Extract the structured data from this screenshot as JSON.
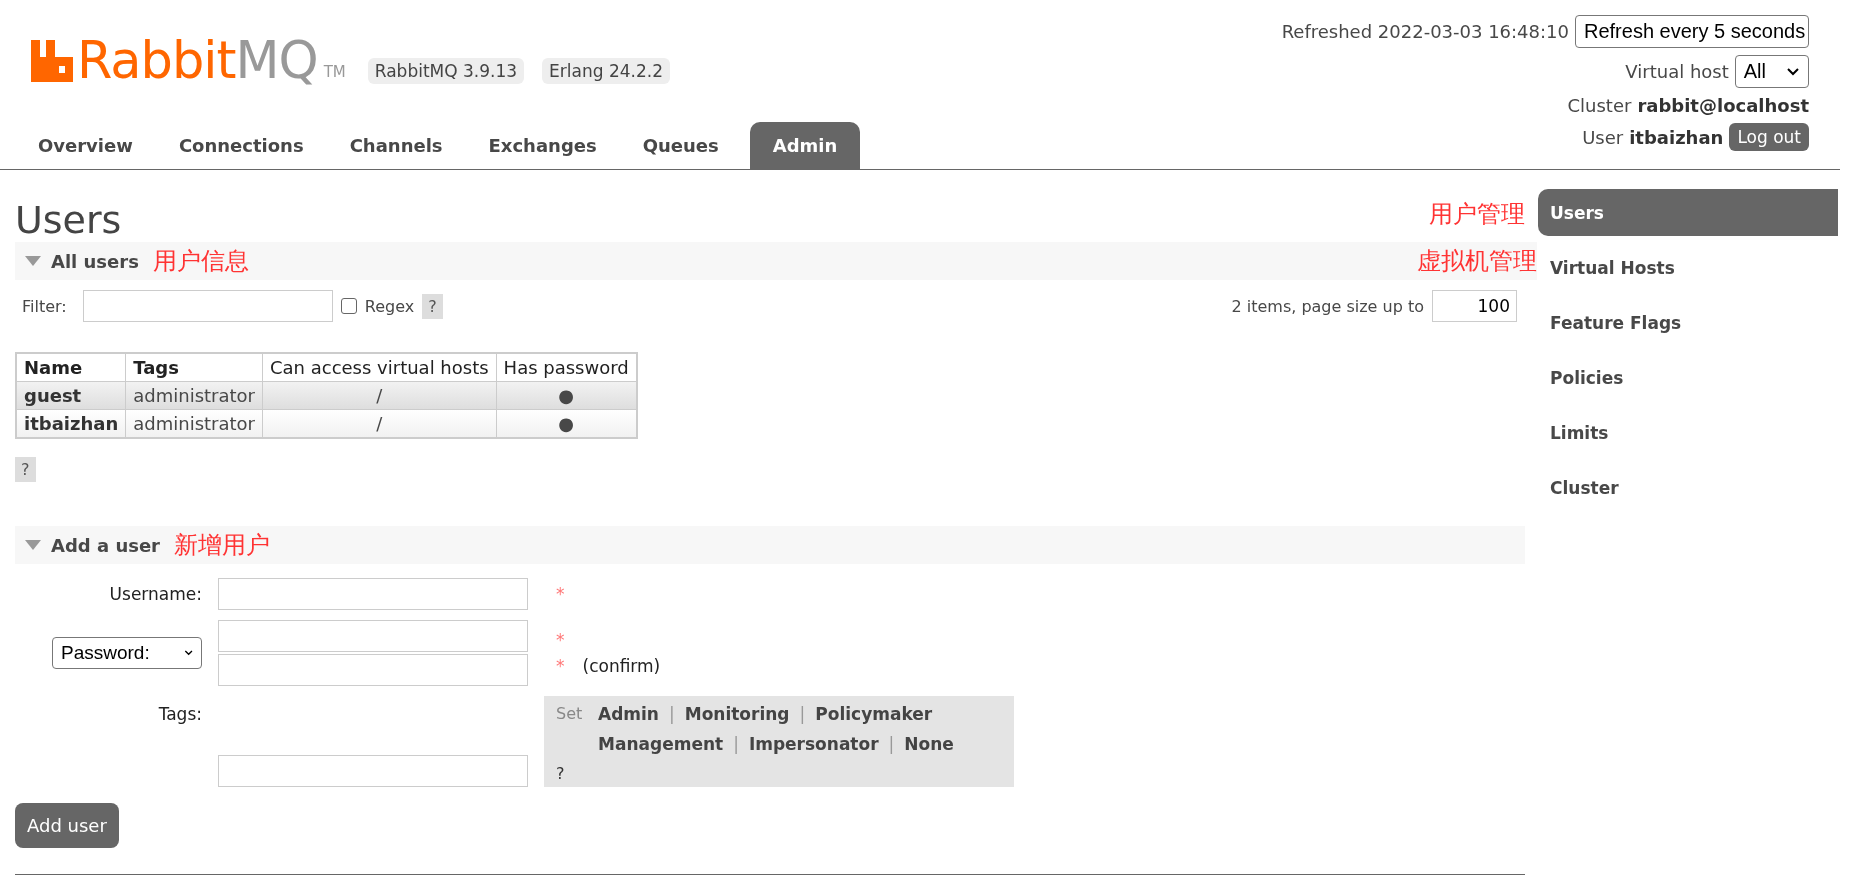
{
  "header": {
    "logo": {
      "part1": "Rabbit",
      "part2": "MQ",
      "trademark": "TM"
    },
    "versions": [
      "RabbitMQ 3.9.13",
      "Erlang 24.2.2"
    ],
    "tabs": [
      {
        "label": "Overview",
        "selected": false
      },
      {
        "label": "Connections",
        "selected": false
      },
      {
        "label": "Channels",
        "selected": false
      },
      {
        "label": "Exchanges",
        "selected": false
      },
      {
        "label": "Queues",
        "selected": false
      },
      {
        "label": "Admin",
        "selected": true
      }
    ],
    "refreshed": "Refreshed 2022-03-03 16:48:10",
    "refresh_select": "Refresh every 5 seconds",
    "vhost_label": "Virtual host",
    "vhost_select": "All",
    "cluster_label": "Cluster",
    "cluster": "rabbit@localhost",
    "user_label": "User",
    "user": "itbaizhan",
    "logout": "Log out"
  },
  "page_title": "Users",
  "annotations": {
    "users_admin": "用户管理",
    "vhost_admin": "虚拟机管理",
    "user_info": "用户信息",
    "add_user": "新增用户"
  },
  "all_users": {
    "title": "All users",
    "filter_label": "Filter:",
    "regex_label": "Regex",
    "regex_checked": false,
    "help": "?",
    "count_text": "2 items, page size up to",
    "page_size": "100",
    "columns": [
      "Name",
      "Tags",
      "Can access virtual hosts",
      "Has password"
    ],
    "rows": [
      {
        "name": "guest",
        "tags": "administrator",
        "vhosts": "/",
        "has_password": "●"
      },
      {
        "name": "itbaizhan",
        "tags": "administrator",
        "vhosts": "/",
        "has_password": "●"
      }
    ],
    "table_help": "?"
  },
  "add_user": {
    "title": "Add a user",
    "username_label": "Username:",
    "password_select": "Password:",
    "required": "*",
    "confirm": "(confirm)",
    "tags_label": "Tags:",
    "set_label": "Set",
    "separator": "|",
    "tag_rows": [
      [
        "Admin",
        "Monitoring",
        "Policymaker"
      ],
      [
        "Management",
        "Impersonator",
        "None"
      ]
    ],
    "help": "?",
    "submit": "Add user"
  },
  "sidebar": [
    {
      "label": "Users",
      "selected": true
    },
    {
      "label": "Virtual Hosts",
      "selected": false
    },
    {
      "label": "Feature Flags",
      "selected": false
    },
    {
      "label": "Policies",
      "selected": false
    },
    {
      "label": "Limits",
      "selected": false
    },
    {
      "label": "Cluster",
      "selected": false
    }
  ]
}
